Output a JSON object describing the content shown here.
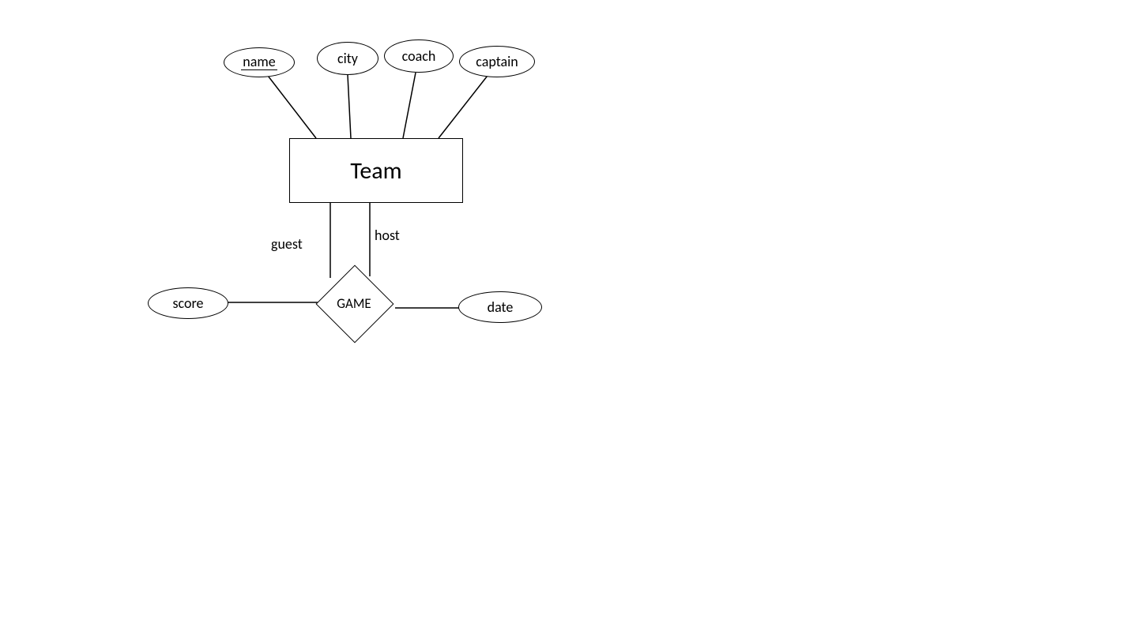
{
  "entities": {
    "team": {
      "label": "Team"
    }
  },
  "relationships": {
    "game": {
      "label": "GAME"
    }
  },
  "attributes": {
    "name": {
      "label": "name",
      "is_key": true
    },
    "city": {
      "label": "city",
      "is_key": false
    },
    "coach": {
      "label": "coach",
      "is_key": false
    },
    "captain": {
      "label": "captain",
      "is_key": false
    },
    "score": {
      "label": "score",
      "is_key": false
    },
    "date": {
      "label": "date",
      "is_key": false
    }
  },
  "roles": {
    "guest": {
      "label": "guest"
    },
    "host": {
      "label": "host"
    }
  },
  "diagram": {
    "type": "ER",
    "entity_attributes": {
      "Team": [
        "name",
        "city",
        "coach",
        "captain"
      ]
    },
    "relationship_attributes": {
      "GAME": [
        "score",
        "date"
      ]
    },
    "relationship_roles": {
      "GAME": {
        "participants": [
          {
            "entity": "Team",
            "role": "guest"
          },
          {
            "entity": "Team",
            "role": "host"
          }
        ]
      }
    }
  }
}
